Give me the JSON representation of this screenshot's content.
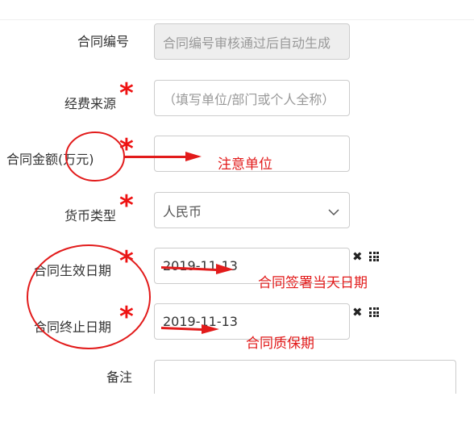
{
  "form": {
    "contract_no": {
      "label": "合同编号",
      "value": "合同编号审核通过后自动生成"
    },
    "funding_source": {
      "label": "经费来源",
      "required": "*",
      "placeholder": "（填写单位/部门或个人全称）"
    },
    "amount": {
      "label_main": "合同金额",
      "label_unit": "(万元)",
      "required": "*",
      "value": ""
    },
    "currency": {
      "label": "货币类型",
      "required": "*",
      "value": "人民币"
    },
    "start_date": {
      "label": "合同生效日期",
      "required": "*",
      "value": "2019-11-13"
    },
    "end_date": {
      "label": "合同终止日期",
      "required": "*",
      "value": "2019-11-13"
    },
    "remarks": {
      "label": "备注",
      "value": ""
    }
  },
  "annotations": {
    "amount_note": "注意单位",
    "start_note": "合同签署当天日期",
    "end_note": "合同质保期"
  },
  "icons": {
    "clear": "clear-icon",
    "calendar": "calendar-grid-icon",
    "chevron": "chevron-down-icon"
  },
  "colors": {
    "annotation": "#e21b1b",
    "required": "#ee1111",
    "border": "#cccccc",
    "disabled_bg": "#eeeeee"
  }
}
